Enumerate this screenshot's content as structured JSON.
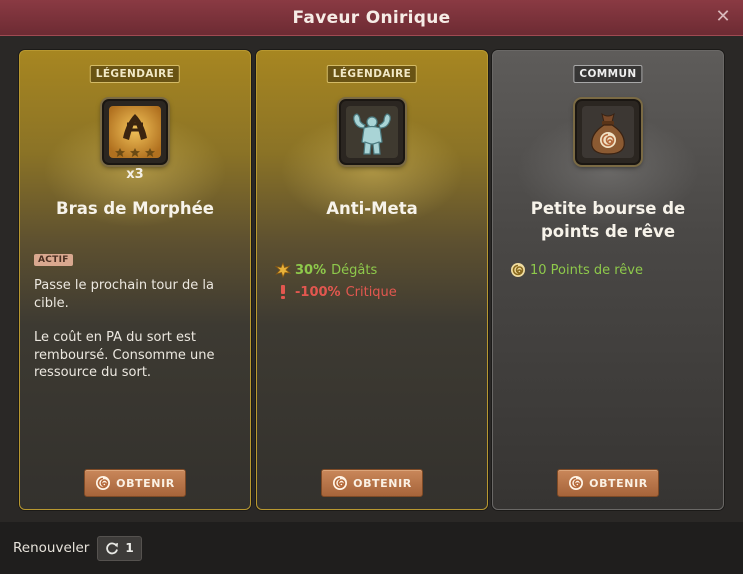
{
  "dialog": {
    "title": "Faveur Onirique"
  },
  "cards": [
    {
      "rarity": "LÉGENDAIRE",
      "icon": "morpheus-arm-icon",
      "count": "x3",
      "name": "Bras de Morphée",
      "badge": "ACTIF",
      "description": [
        "Passe le prochain tour de la cible.",
        "Le coût en PA du sort est remboursé. Consomme une ressource du sort."
      ],
      "button": "OBTENIR"
    },
    {
      "rarity": "LÉGENDAIRE",
      "icon": "muscle-statue-icon",
      "name": "Anti-Meta",
      "effects": [
        {
          "value": "30%",
          "label": "Dégâts",
          "icon": "damage-burst-icon",
          "color": "#8ec94b"
        },
        {
          "value": "-100%",
          "label": "Critique",
          "icon": "exclamation-icon",
          "color": "#e2574f"
        }
      ],
      "button": "OBTENIR"
    },
    {
      "rarity": "COMMUN",
      "icon": "money-bag-icon",
      "name": "Petite bourse de points de rêve",
      "effects": [
        {
          "value": "10 Points de rêve",
          "icon": "dream-point-icon",
          "color": "#8ec94b"
        }
      ],
      "button": "OBTENIR"
    }
  ],
  "footer": {
    "label": "Renouveler",
    "count": "1"
  },
  "colors": {
    "title_bar": "#7a323b",
    "legendary": "#a78621",
    "common": "#5e5c5a",
    "button": "#b8744a",
    "positive": "#8ec94b",
    "negative": "#e2574f"
  }
}
